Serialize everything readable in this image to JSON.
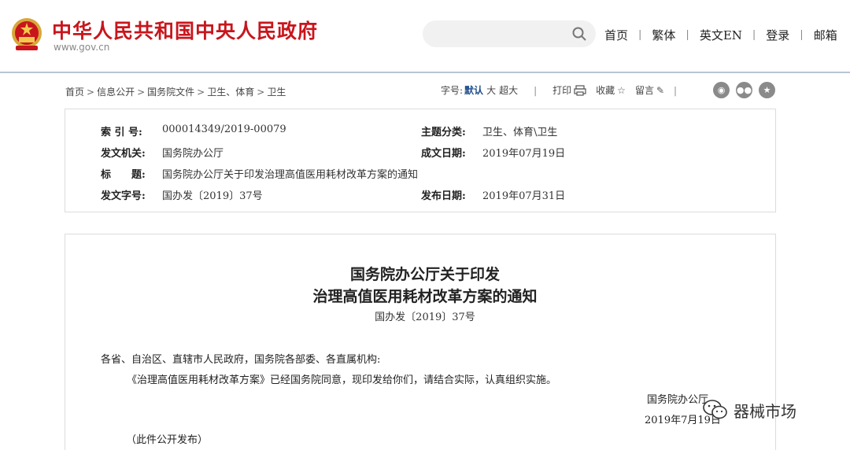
{
  "header": {
    "site_title": "中华人民共和国中央人民政府",
    "site_url": "www.gov.cn",
    "search_placeholder": "",
    "nav": [
      "首页",
      "繁体",
      "英文EN",
      "登录",
      "邮箱"
    ]
  },
  "breadcrumb": [
    "首页",
    "信息公开",
    "国务院文件",
    "卫生、体育",
    "卫生"
  ],
  "toolbar": {
    "font_size_label": "字号:",
    "font_default": "默认",
    "font_large": "大",
    "font_xlarge": "超大",
    "print": "打印",
    "favorite": "收藏",
    "comment": "留言"
  },
  "info": {
    "index_label": "索 引 号:",
    "index_value": "000014349/2019-00079",
    "category_label": "主题分类:",
    "category_value": "卫生、体育\\卫生",
    "issuer_label": "发文机关:",
    "issuer_value": "国务院办公厅",
    "written_label": "成文日期:",
    "written_value": "2019年07月19日",
    "title_label": "标　　题:",
    "title_value": "国务院办公厅关于印发治理高值医用耗材改革方案的通知",
    "docno_label": "发文字号:",
    "docno_value": "国办发〔2019〕37号",
    "published_label": "发布日期:",
    "published_value": "2019年07月31日"
  },
  "document": {
    "title_line1": "国务院办公厅关于印发",
    "title_line2": "治理高值医用耗材改革方案的通知",
    "number": "国办发〔2019〕37号",
    "salutation": "各省、自治区、直辖市人民政府，国务院各部委、各直属机构:",
    "body": "《治理高值医用耗材改革方案》已经国务院同意，现印发给你们，请结合实际，认真组织实施。",
    "signature": "国务院办公厅",
    "date": "2019年7月19日",
    "note": "（此件公开发布）"
  },
  "watermark": "器械市场",
  "colors": {
    "brand_red": "#c8161d",
    "link_blue": "#1f4e8c",
    "divider": "#b9c6d3"
  }
}
